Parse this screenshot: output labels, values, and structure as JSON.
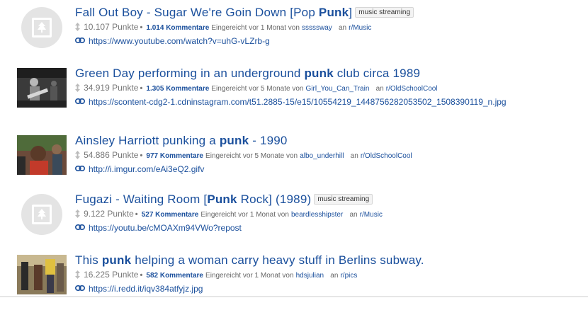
{
  "results": [
    {
      "title_pre": "Fall Out Boy - Sugar We're Goin Down [Pop ",
      "title_hl": "Punk",
      "title_post": "]",
      "flair": "music streaming",
      "points": "10.107 Punkte",
      "comments": "1.014 Kommentare",
      "submitted": "Eingereicht vor 1 Monat von",
      "author": "sssssway",
      "in": "an",
      "subreddit": "r/Music",
      "url": "https://www.youtube.com/watch?v=uhG-vLZrb-g",
      "thumb": "default"
    },
    {
      "title_pre": "Green Day performing in an underground ",
      "title_hl": "punk",
      "title_post": " club circa 1989",
      "flair": "",
      "points": "34.919 Punkte",
      "comments": "1.305 Kommentare",
      "submitted": "Eingereicht vor 5 Monate von",
      "author": "Girl_You_Can_Train",
      "in": "an",
      "subreddit": "r/OldSchoolCool",
      "url": "https://scontent-cdg2-1.cdninstagram.com/t51.2885-15/e15/10554219_1448756282053502_1508390119_n.jpg",
      "thumb": "photo-bw"
    },
    {
      "title_pre": "Ainsley Harriott punking a ",
      "title_hl": "punk",
      "title_post": " - 1990",
      "flair": "",
      "points": "54.886 Punkte",
      "comments": "977 Kommentare",
      "submitted": "Eingereicht vor 5 Monate von",
      "author": "albo_underhill",
      "in": "an",
      "subreddit": "r/OldSchoolCool",
      "url": "http://i.imgur.com/eAi3eQ2.gifv",
      "thumb": "photo-color"
    },
    {
      "title_pre": "Fugazi - Waiting Room [",
      "title_hl": "Punk",
      "title_post": " Rock] (1989)",
      "flair": "music streaming",
      "points": "9.122 Punkte",
      "comments": "527 Kommentare",
      "submitted": "Eingereicht vor 1 Monat von",
      "author": "beardlesshipster",
      "in": "an",
      "subreddit": "r/Music",
      "url": "https://youtu.be/cMOAXm94VWo?repost",
      "thumb": "default"
    },
    {
      "title_pre": "This ",
      "title_hl": "punk",
      "title_post": " helping a woman carry heavy stuff in Berlins subway.",
      "flair": "",
      "points": "16.225 Punkte",
      "comments": "582 Kommentare",
      "submitted": "Eingereicht vor 1 Monat von",
      "author": "hdsjulian",
      "in": "an",
      "subreddit": "r/pics",
      "url": "https://i.redd.it/iqv384atfyjz.jpg",
      "thumb": "photo-subway"
    }
  ]
}
